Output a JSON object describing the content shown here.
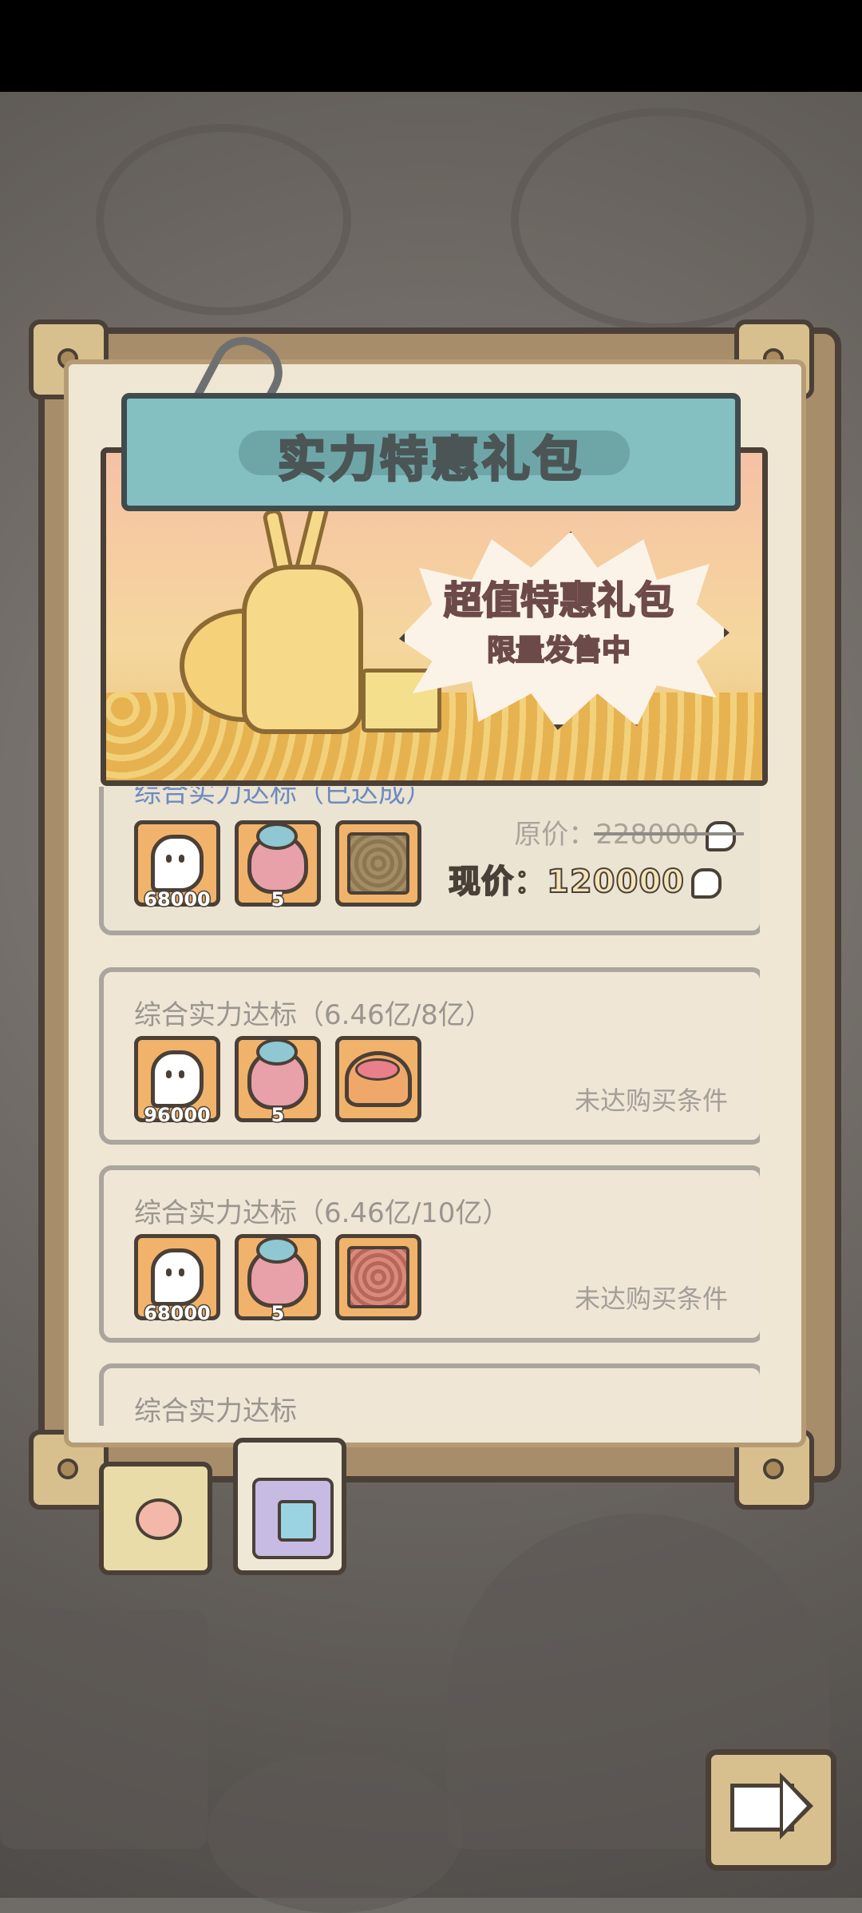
{
  "banner": {
    "title": "实力特惠礼包"
  },
  "hero": {
    "headline": "超值特惠礼包",
    "subline": "限量发售中"
  },
  "packs": [
    {
      "title": "综合实力达标（已达成）",
      "state": "achieved",
      "items": [
        {
          "icon": "ghost-currency-icon",
          "count": "68000"
        },
        {
          "icon": "pouch-icon",
          "count": "5"
        },
        {
          "icon": "wood-frame-icon",
          "count": ""
        }
      ],
      "original_price_label": "原价：228000",
      "current_price_label": "现价：120000"
    },
    {
      "title": "综合实力达标（6.46亿/8亿）",
      "state": "locked",
      "items": [
        {
          "icon": "ghost-currency-icon",
          "count": "96000"
        },
        {
          "icon": "pouch-icon",
          "count": "5"
        },
        {
          "icon": "cake-icon",
          "count": ""
        }
      ],
      "condition": "未达购买条件"
    },
    {
      "title": "综合实力达标（6.46亿/10亿）",
      "state": "locked",
      "items": [
        {
          "icon": "ghost-currency-icon",
          "count": "68000"
        },
        {
          "icon": "pouch-icon",
          "count": "5"
        },
        {
          "icon": "red-frame-icon",
          "count": ""
        }
      ],
      "condition": "未达购买条件"
    },
    {
      "title": "综合实力达标",
      "state": "partial"
    }
  ],
  "tabs": [
    {
      "icon": "snail-icon"
    },
    {
      "icon": "gift-box-icon"
    }
  ],
  "next_button": {
    "icon": "arrow-right-icon"
  },
  "colors": {
    "banner": "#84bfc1",
    "card": "#efe6d6",
    "achieved_title": "#6d8bbf",
    "board": "#a88d6a"
  }
}
